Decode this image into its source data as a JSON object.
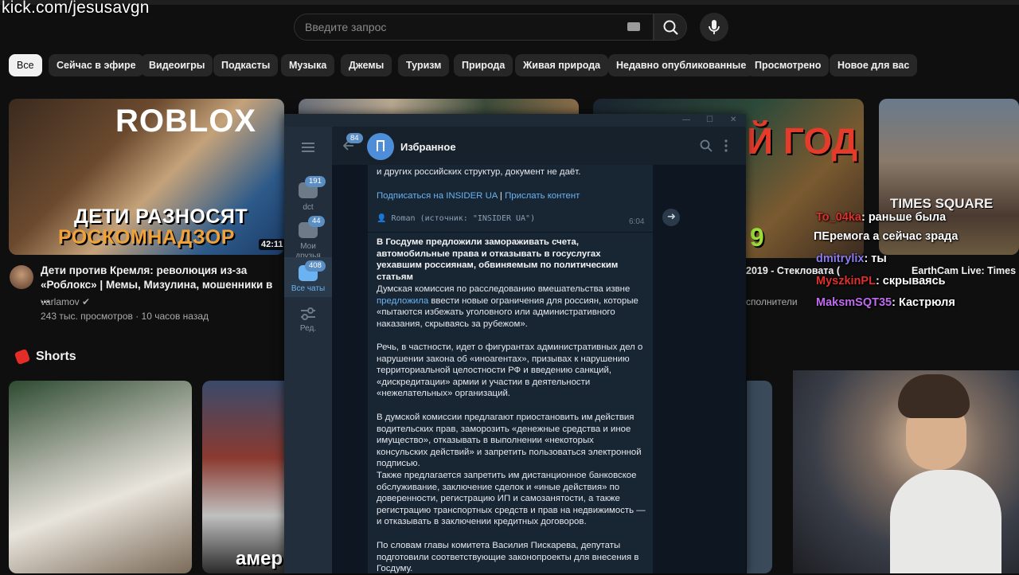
{
  "watermark": "kick.com/jesusavgn",
  "search": {
    "placeholder": "Введите запрос"
  },
  "chips": [
    "Все",
    "Сейчас в эфире",
    "Видеоигры",
    "Подкасты",
    "Музыка",
    "Джемы",
    "Туризм",
    "Природа",
    "Живая природа",
    "Недавно опубликованные",
    "Просмотрено",
    "Новое для вас"
  ],
  "video1": {
    "thumb_top": "ROBLOX",
    "thumb_line1": "ДЕТИ РАЗНОСЯТ",
    "thumb_line2": "РОСКОМНАДЗОР",
    "duration": "42:11",
    "title": "Дети против Кремля: революция из-за «Роблокс» | Мемы, Мизулина, мошенники в ...",
    "channel": "varlamov ✔",
    "views": "243 тыс. просмотров · 10 часов назад"
  },
  "video3": {
    "thumb_text": "Й ГОД",
    "thumb_num": "9",
    "title": "2019 - Стекловата (",
    "channel": "сполнители"
  },
  "video4": {
    "thumb_text": "TIMES SQUARE",
    "title": "EarthCam Live: Times"
  },
  "shorts": {
    "title": "Shorts",
    "short2_text": "амер"
  },
  "chat_overlay": [
    {
      "user": "To_04ka",
      "text": ": раньше была",
      "color": "#e0302c"
    },
    {
      "user": "",
      "text": "ПЕремога а сейчас зрада",
      "color": "#ffffff"
    },
    {
      "user": "dmitrylix",
      "text": ": ты",
      "color": "#8a7cf0"
    },
    {
      "user": "MyszkinPL",
      "text": ": скрываясь",
      "color": "#e0302c"
    },
    {
      "user": "MaksmSQT35",
      "text": ": Кастрюля",
      "color": "#c06cf0"
    }
  ],
  "telegram": {
    "back_badge": "84",
    "chat_name": "Избранное",
    "folders": [
      {
        "label": "dct",
        "badge": "191"
      },
      {
        "label": "Мои друзья",
        "badge": "44"
      },
      {
        "label": "Все чаты",
        "badge": "408"
      },
      {
        "label": "Ред.",
        "badge": ""
      }
    ],
    "msg_prev_tail": "и других российских структур, документ не даёт.",
    "sub_link": "Подписаться на INSIDER UA",
    "sep": " | ",
    "send_link": "Прислать контент",
    "forward_line": "👤 Roman (источник: \"INSIDER UA\")",
    "time": "6:04",
    "p1": "В Госдуме предложили замораживать счета, автомобильные права и отказывать в госуслугах уехавшим россиянам, обвиняемым по политическим статьям",
    "p2_before": "Думская комиссия по расследованию вмешательства извне ",
    "p2_link": "предложила",
    "p2_after": " ввести новые ограничения для россиян, которые «пытаются избежать уголовного или административного наказания, скрываясь за рубежом».",
    "p3": "Речь, в частности, идет о фигурантах административных дел о нарушении закона об «иноагентах», призывах к нарушению территориальной целостности РФ и введению санкций, «дискредитации» армии и участии в деятельности «нежелательных» организаций.",
    "p4": "В думской комиссии предлагают приостановить им действия водительских прав, заморозить «денежные средства и иное имущество», отказывать в выполнении «некоторых консульских действий» и запретить пользоваться электронной подписью.",
    "p5": "Также предлагается запретить им дистанционное банковское обслуживание, заключение сделок и «иные действия» по доверенности, регистрацию ИП и самозанятости, а также регистрацию транспортных средств и прав на недвижимость — и отказывать в заключении кредитных договоров.",
    "p6": "По словам главы комитета Василия Пискарева, депутаты подготовили соответствующие законопроекты для внесения в Госдуму."
  }
}
